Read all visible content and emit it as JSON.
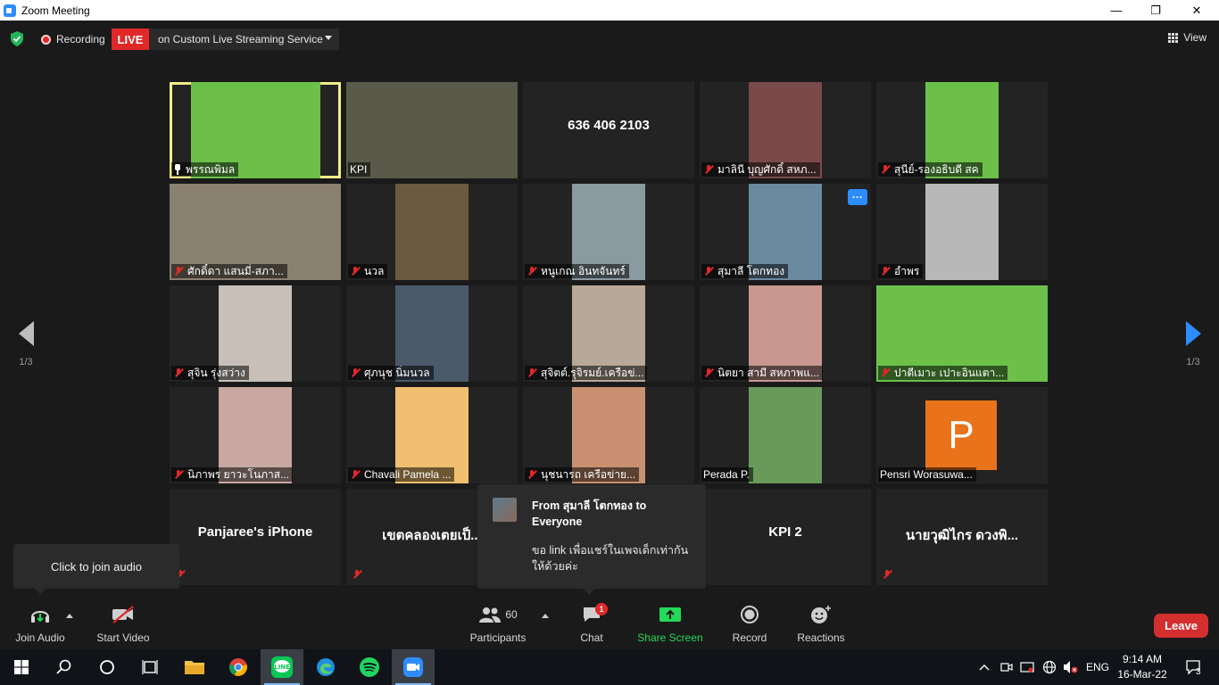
{
  "window": {
    "title": "Zoom Meeting",
    "minimize": "—",
    "maximize": "❐",
    "close": "✕"
  },
  "topbar": {
    "recording_label": "Recording",
    "live_label": "LIVE",
    "live_service": "on Custom Live Streaming Service",
    "view_label": "View"
  },
  "pagination": {
    "left": "1/3",
    "right": "1/3"
  },
  "tiles": [
    {
      "name": "พรรณพิมล",
      "type": "video",
      "pinned": true,
      "muted": false,
      "active": true,
      "bg": "#6cc04a"
    },
    {
      "name": "KPI",
      "type": "video",
      "muted": false,
      "bg": "#5a5a4a"
    },
    {
      "name": "",
      "type": "placeholder",
      "text": "636 406 2103"
    },
    {
      "name": "มาลินี บุญศักดิ์ สหภ...",
      "type": "video",
      "muted": true,
      "bg": "#7a4a4a"
    },
    {
      "name": "สุนีย์-รองอธิบดี สค",
      "type": "video",
      "muted": true,
      "bg": "#6cc04a"
    },
    {
      "name": "ศักดิ์ดา  แสนมี่-สภา...",
      "type": "video",
      "muted": true,
      "bg": "#8a8070"
    },
    {
      "name": "นวล",
      "type": "video",
      "muted": true,
      "bg": "#6a5a40"
    },
    {
      "name": "หนูเกณ อินทจันทร์",
      "type": "video",
      "muted": true,
      "bg": "#8a9aa0"
    },
    {
      "name": "สุมาลี โตกทอง",
      "type": "video",
      "muted": true,
      "bg": "#6a8aa0",
      "more": "···"
    },
    {
      "name": "อำพร",
      "type": "video",
      "muted": true,
      "bg": "#b8b8b8"
    },
    {
      "name": "สุจิน รุ่งสว่าง",
      "type": "video",
      "muted": true,
      "bg": "#c8c0b8"
    },
    {
      "name": "ศุภนุช นิ่มนวล",
      "type": "video",
      "muted": true,
      "bg": "#4a5a6a"
    },
    {
      "name": "สุจิตต์.รุจิรมย์.เครือข่...",
      "type": "video",
      "muted": true,
      "bg": "#b8a898"
    },
    {
      "name": "นิตยา สามี สหภาพแ...",
      "type": "video",
      "muted": true,
      "bg": "#c89890"
    },
    {
      "name": "ปาตีเมาะ เปาะอินแตา...",
      "type": "video",
      "muted": true,
      "bg": "#6cc04a"
    },
    {
      "name": "นิภาพร ยาวะโนภาส...",
      "type": "video",
      "muted": true,
      "bg": "#c8a8a0"
    },
    {
      "name": "Chavali Pamela ...",
      "type": "video",
      "muted": true,
      "bg": "#f0c070"
    },
    {
      "name": "นุชนารถ  เครือข่าย...",
      "type": "video",
      "muted": true,
      "bg": "#c89070"
    },
    {
      "name": "Perada P.",
      "type": "video",
      "muted": false,
      "bg": "#6a9a5a"
    },
    {
      "name": "Pensri Worasuwa...",
      "type": "avatar",
      "muted": false,
      "letter": "P",
      "bg": "#e8731a"
    },
    {
      "name": "",
      "type": "placeholder",
      "text": "Panjaree's iPhone",
      "muted": true
    },
    {
      "name": "",
      "type": "placeholder",
      "text": "เขตคลองเตยเป็...",
      "muted": true
    },
    {
      "name": "",
      "type": "placeholder",
      "text": "",
      "muted": false
    },
    {
      "name": "",
      "type": "placeholder",
      "text": "KPI 2",
      "muted": false
    },
    {
      "name": "",
      "type": "placeholder",
      "text": "นายวุฒิไกร ดวงพิ...",
      "muted": true
    }
  ],
  "tooltip": {
    "text": "Click to join audio"
  },
  "chat": {
    "from": "From สุมาลี โตกทอง to Everyone",
    "message": "ขอ link เพื่อแชร์ในเพจเด็กเท่ากันให้ด้วยค่ะ"
  },
  "toolbar": {
    "join_audio": "Join Audio",
    "start_video": "Start Video",
    "participants_count": "60",
    "participants": "Participants",
    "chat": "Chat",
    "chat_badge": "1",
    "share_screen": "Share Screen",
    "record": "Record",
    "reactions": "Reactions",
    "leave": "Leave"
  },
  "taskbar": {
    "lang": "ENG",
    "time": "9:14 AM",
    "date": "16-Mar-22",
    "notifications": "3"
  },
  "colors": {
    "accent": "#2d8cff",
    "live": "#e02828",
    "share": "#23d959",
    "leave": "#d32f2f",
    "highlight": "#f3ee8a"
  }
}
